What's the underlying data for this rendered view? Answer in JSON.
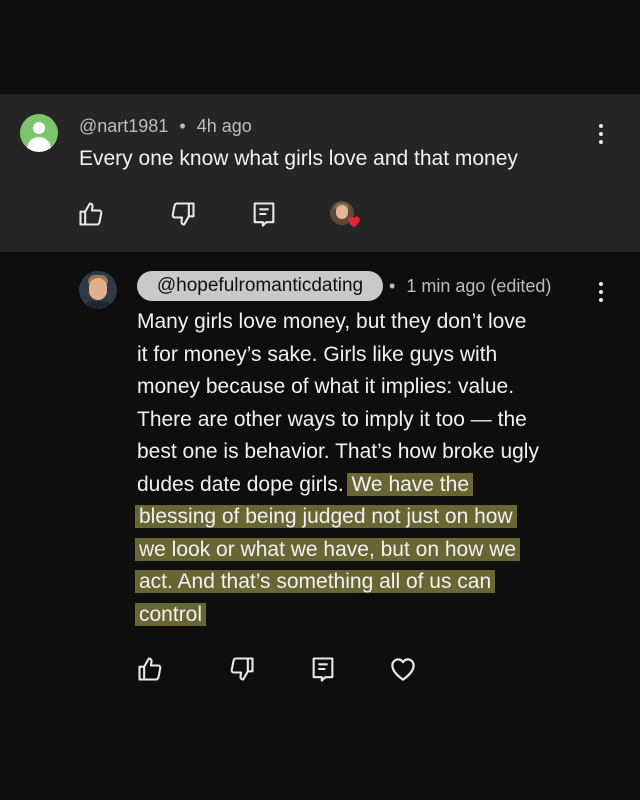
{
  "parent_comment": {
    "handle": "@nart1981",
    "separator": "•",
    "time": "4h ago",
    "text": "Every one know what girls love and that money",
    "avatar_icon": "person-placeholder-icon"
  },
  "reply": {
    "handle": "@hopefulromanticdating",
    "separator": "•",
    "time": "1 min ago (edited)",
    "lines": [
      "Many girls love money, but they don’t love",
      "it for money’s sake. Girls like guys with",
      "money because of what it implies: value.",
      "There are other ways to imply it too — the",
      "best one is behavior. That’s how broke ugly"
    ],
    "line6_plain": "dudes date dope girls. ",
    "line6_highlight": "We have the",
    "highlight_lines": [
      "blessing of being judged not just on how",
      "we look or what we have, but on how we",
      "act. And that’s something all of us can",
      "control"
    ]
  },
  "icons": {
    "like": "thumbs-up-icon",
    "dislike": "thumbs-down-icon",
    "reply": "reply-icon",
    "heart": "heart-icon",
    "more": "more-vert-icon"
  },
  "colors": {
    "background": "#0e0e0e",
    "parent_background": "#252525",
    "highlight": "#78763a",
    "heart_badge": "#e0262f"
  }
}
